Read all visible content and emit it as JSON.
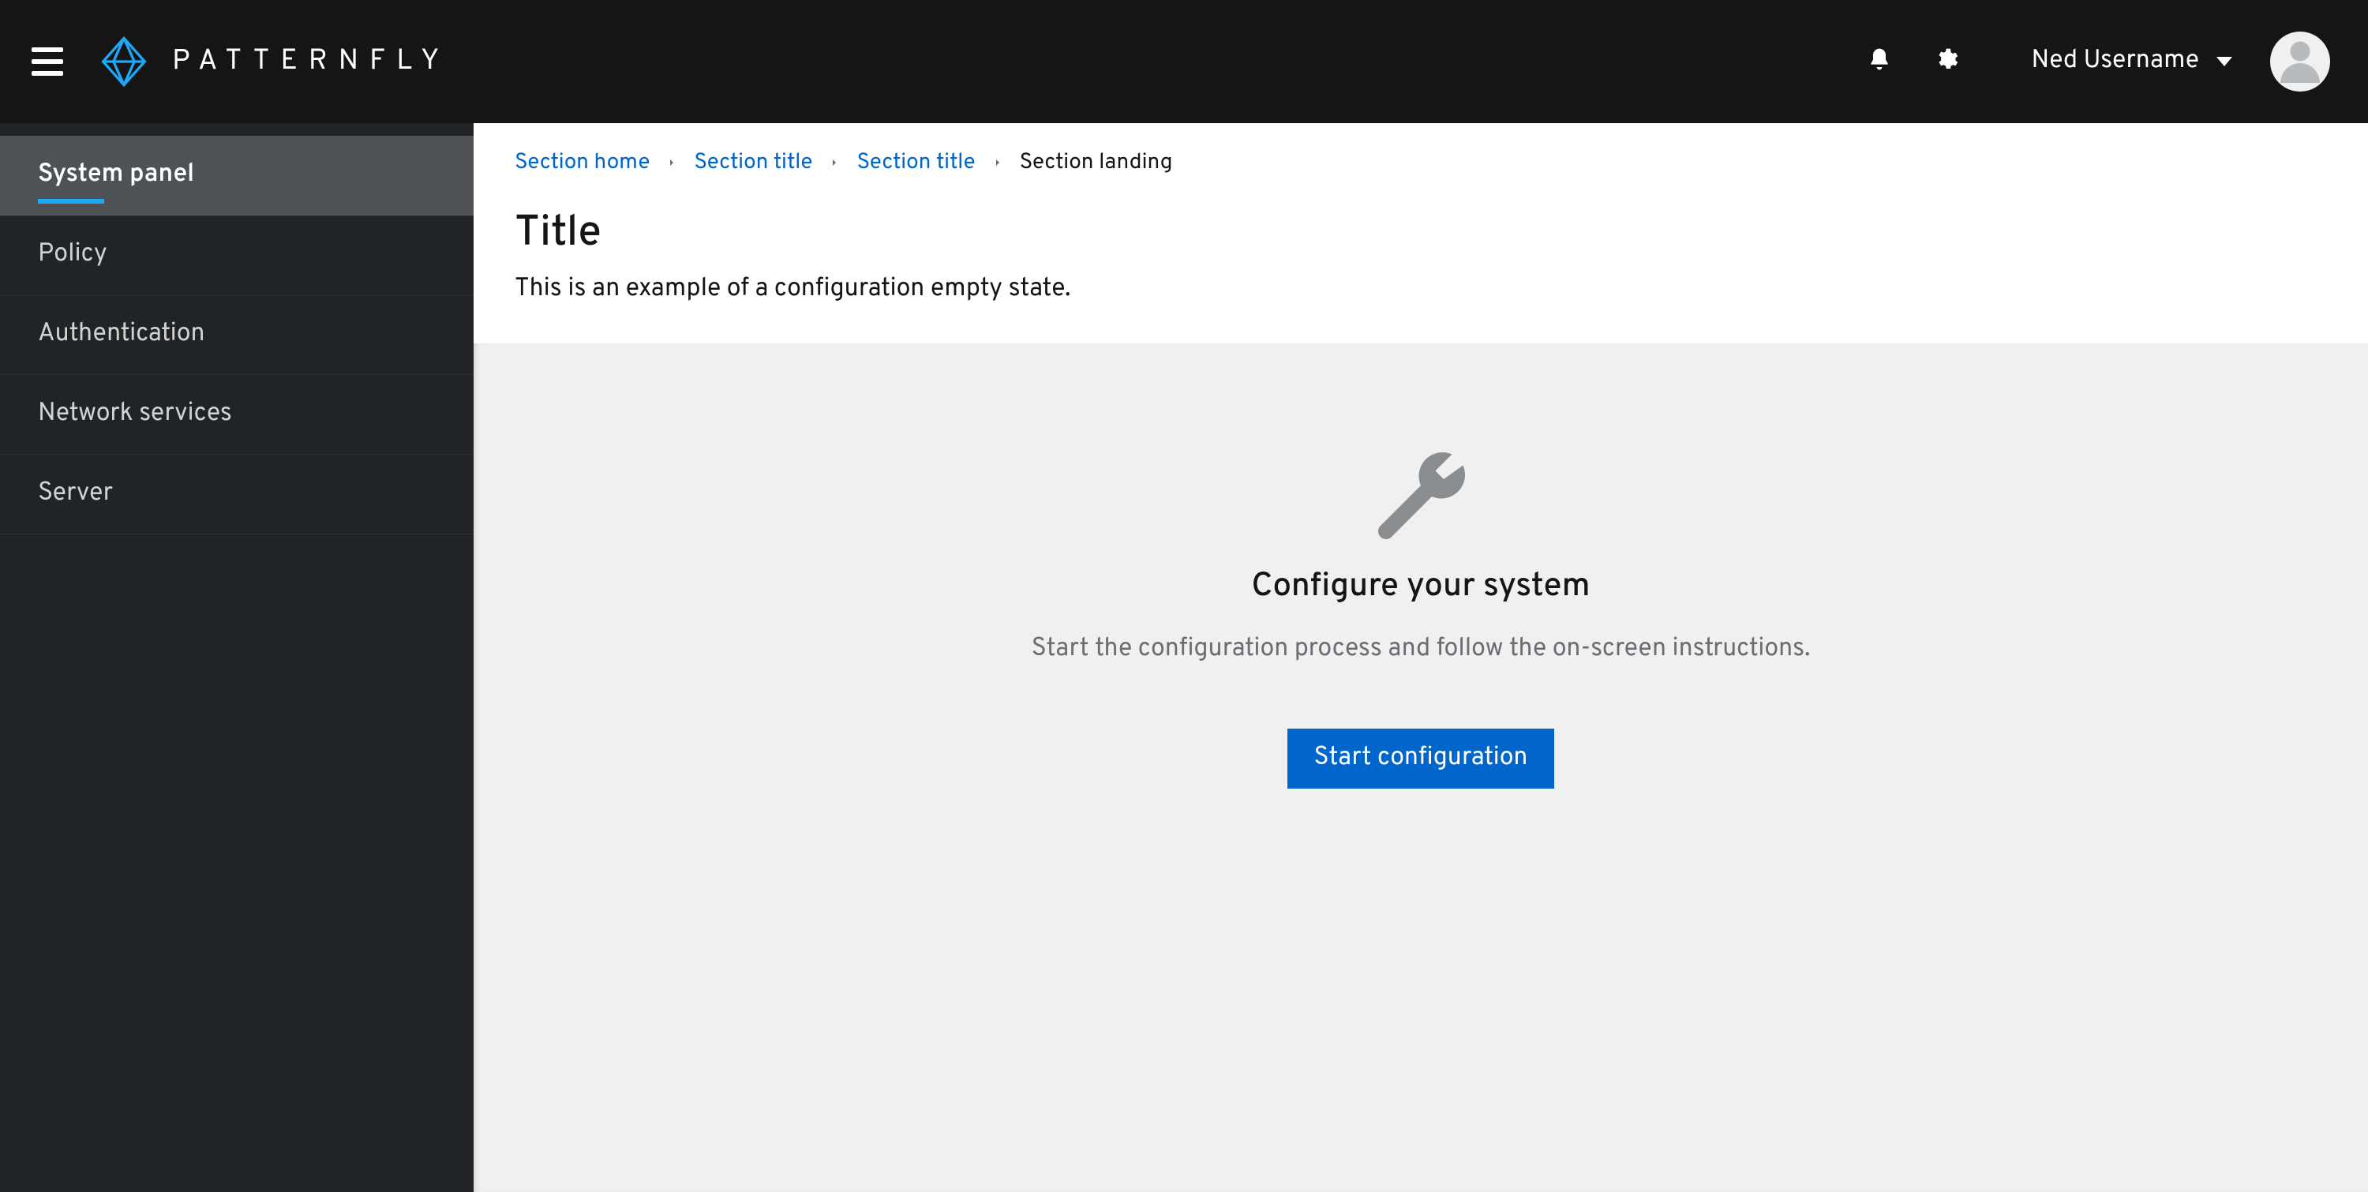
{
  "masthead": {
    "brand_word": "PATTERNFLY",
    "user_name": "Ned Username"
  },
  "sidebar": {
    "items": [
      {
        "label": "System panel",
        "active": true
      },
      {
        "label": "Policy",
        "active": false
      },
      {
        "label": "Authentication",
        "active": false
      },
      {
        "label": "Network services",
        "active": false
      },
      {
        "label": "Server",
        "active": false
      }
    ]
  },
  "breadcrumb": {
    "items": [
      {
        "label": "Section home",
        "current": false
      },
      {
        "label": "Section title",
        "current": false
      },
      {
        "label": "Section title",
        "current": false
      },
      {
        "label": "Section landing",
        "current": true
      }
    ]
  },
  "page": {
    "title": "Title",
    "description": "This is an example of a configuration empty state."
  },
  "empty_state": {
    "title": "Configure your system",
    "body": "Start the configuration process and follow the on-screen instructions.",
    "primary_action_label": "Start configuration"
  }
}
